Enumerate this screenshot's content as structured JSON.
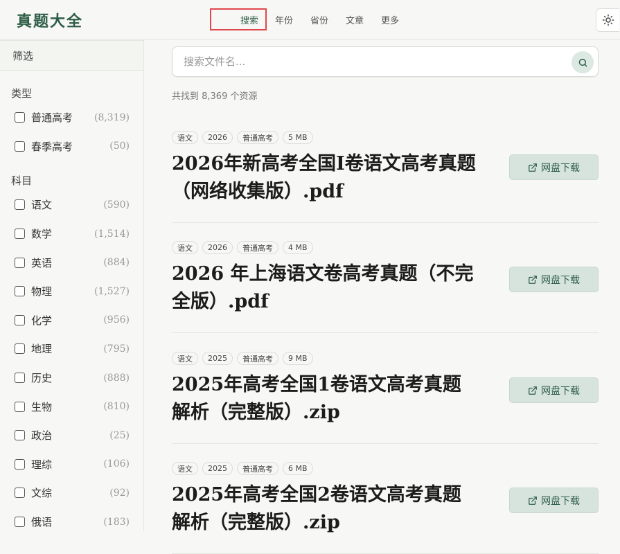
{
  "header": {
    "logo": "真题大全",
    "nav": [
      {
        "label": "搜索",
        "active": true
      },
      {
        "label": "年份",
        "active": false
      },
      {
        "label": "省份",
        "active": false
      },
      {
        "label": "文章",
        "active": false
      },
      {
        "label": "更多",
        "active": false
      }
    ],
    "theme_icon": "sun-icon"
  },
  "sidebar": {
    "filter_label": "筛选",
    "groups": [
      {
        "title": "类型",
        "options": [
          {
            "label": "普通高考",
            "count": "(8,319)"
          },
          {
            "label": "春季高考",
            "count": "(50)"
          }
        ]
      },
      {
        "title": "科目",
        "options": [
          {
            "label": "语文",
            "count": "(590)"
          },
          {
            "label": "数学",
            "count": "(1,514)"
          },
          {
            "label": "英语",
            "count": "(884)"
          },
          {
            "label": "物理",
            "count": "(1,527)"
          },
          {
            "label": "化学",
            "count": "(956)"
          },
          {
            "label": "地理",
            "count": "(795)"
          },
          {
            "label": "历史",
            "count": "(888)"
          },
          {
            "label": "生物",
            "count": "(810)"
          },
          {
            "label": "政治",
            "count": "(25)"
          },
          {
            "label": "理综",
            "count": "(106)"
          },
          {
            "label": "文综",
            "count": "(92)"
          },
          {
            "label": "俄语",
            "count": "(183)"
          }
        ]
      }
    ]
  },
  "search": {
    "placeholder": "搜索文件名..."
  },
  "result_count": "共找到 8,369 个资源",
  "download_label": "网盘下载",
  "results": [
    {
      "tags": [
        "语文",
        "2026",
        "普通高考",
        "5 MB"
      ],
      "title": "2026年新高考全国Ⅰ卷语文高考真题（网络收集版）.pdf"
    },
    {
      "tags": [
        "语文",
        "2026",
        "普通高考",
        "4 MB"
      ],
      "title": "2026 年上海语文卷高考真题（不完全版）.pdf"
    },
    {
      "tags": [
        "语文",
        "2025",
        "普通高考",
        "9 MB"
      ],
      "title": "2025年高考全国1卷语文高考真题解析（完整版）.zip"
    },
    {
      "tags": [
        "语文",
        "2025",
        "普通高考",
        "6 MB"
      ],
      "title": "2025年高考全国2卷语文高考真题解析（完整版）.zip"
    }
  ]
}
